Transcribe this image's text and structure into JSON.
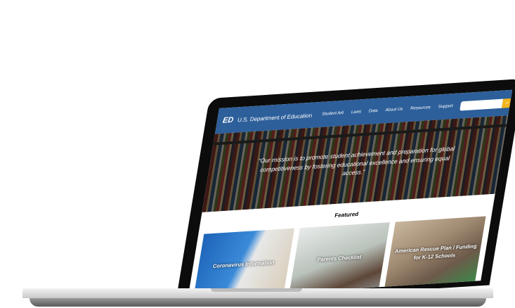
{
  "header": {
    "logo": "ED",
    "title": "U.S. Department of Education",
    "nav": [
      "Student Aid",
      "Laws",
      "Data",
      "About Us",
      "Resources",
      "Support"
    ],
    "search_placeholder": "",
    "search_icon": "search-icon"
  },
  "hero": {
    "quote": "“Our mission is to promote student achievement and preparation for global competitiveness by fostering educational excellence and ensuring equal access.”"
  },
  "featured": {
    "title": "Featured",
    "cards": [
      "Coronavirus Information",
      "Parents Checklist",
      "American Rescue Plan / Funding for K-12 Schools"
    ]
  },
  "colors": {
    "nav": "#2d5f9a",
    "search_button": "#f2b51c"
  }
}
